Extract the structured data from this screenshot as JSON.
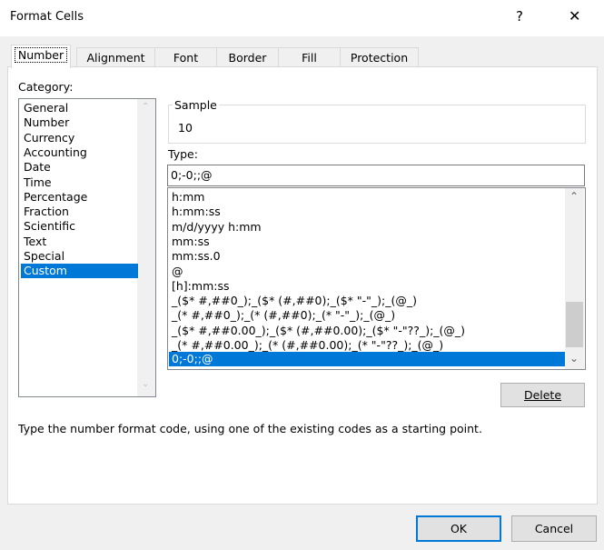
{
  "window": {
    "title": "Format Cells",
    "help": "?",
    "close": "✕"
  },
  "tabs": [
    "Number",
    "Alignment",
    "Font",
    "Border",
    "Fill",
    "Protection"
  ],
  "category": {
    "label": "Category:",
    "items": [
      "General",
      "Number",
      "Currency",
      "Accounting",
      "Date",
      "Time",
      "Percentage",
      "Fraction",
      "Scientific",
      "Text",
      "Special",
      "Custom"
    ],
    "selected": "Custom"
  },
  "sample": {
    "label": "Sample",
    "value": "10"
  },
  "type": {
    "label": "Type:",
    "value": "0;-0;;@",
    "items": [
      "h:mm",
      "h:mm:ss",
      "m/d/yyyy h:mm",
      "mm:ss",
      "mm:ss.0",
      "@",
      "[h]:mm:ss",
      "_($* #,##0_);_($* (#,##0);_($* \"-\"_);_(@_)",
      "_(* #,##0_);_(* (#,##0);_(* \"-\"_);_(@_)",
      "_($* #,##0.00_);_($* (#,##0.00);_($* \"-\"??_);_(@_)",
      "_(* #,##0.00_);_(* (#,##0.00);_(* \"-\"??_);_(@_)",
      "0;-0;;@"
    ],
    "selected": "0;-0;;@"
  },
  "buttons": {
    "delete": "Delete",
    "ok": "OK",
    "cancel": "Cancel"
  },
  "description": "Type the number format code, using one of the existing codes as a starting point.",
  "colors": {
    "selection": "#0078d7"
  }
}
